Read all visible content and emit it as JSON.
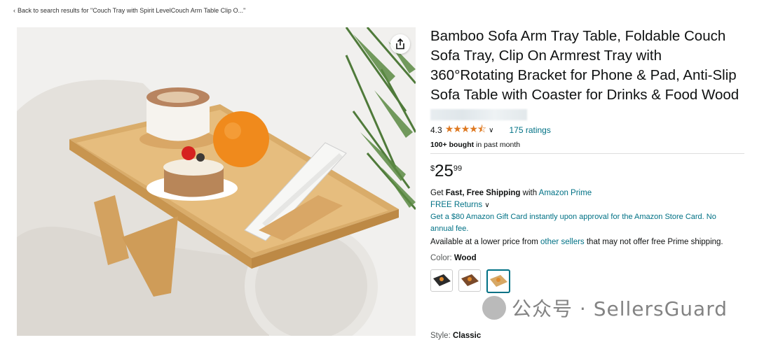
{
  "breadcrumb": {
    "chevron": "‹",
    "text": "Back to search results for \"Couch Tray with Spirit LevelCouch Arm Table Clip O...\""
  },
  "product": {
    "title": "Bamboo Sofa Arm Tray Table, Foldable Couch Sofa Tray, Clip On Armrest Tray with 360°Rotating Bracket for Phone & Pad, Anti-Slip Sofa Table with Coaster for Drinks & Food Wood",
    "rating": "4.3",
    "stars": "★★★★⯪",
    "ratings_count": "175 ratings",
    "bought_bold": "100+ bought",
    "bought_rest": " in past month",
    "price_currency": "$",
    "price_whole": "25",
    "price_fraction": "99"
  },
  "shipping": {
    "prefix": "Get ",
    "bold": "Fast, Free Shipping",
    "middle": " with ",
    "link": "Amazon Prime",
    "returns": "FREE Returns"
  },
  "gift_card": "Get a $80 Amazon Gift Card instantly upon approval for the Amazon Store Card. No annual fee.",
  "lower_price": {
    "prefix": "Available at a lower price from ",
    "link": "other sellers",
    "suffix": " that may not offer free Prime shipping."
  },
  "color": {
    "label": "Color: ",
    "value": "Wood"
  },
  "style": {
    "label": "Style: ",
    "value": "Classic"
  },
  "watermark": "公众号 · SellersGuard",
  "colors": {
    "link": "#007185",
    "star": "#de7921",
    "text": "#0f1111"
  }
}
